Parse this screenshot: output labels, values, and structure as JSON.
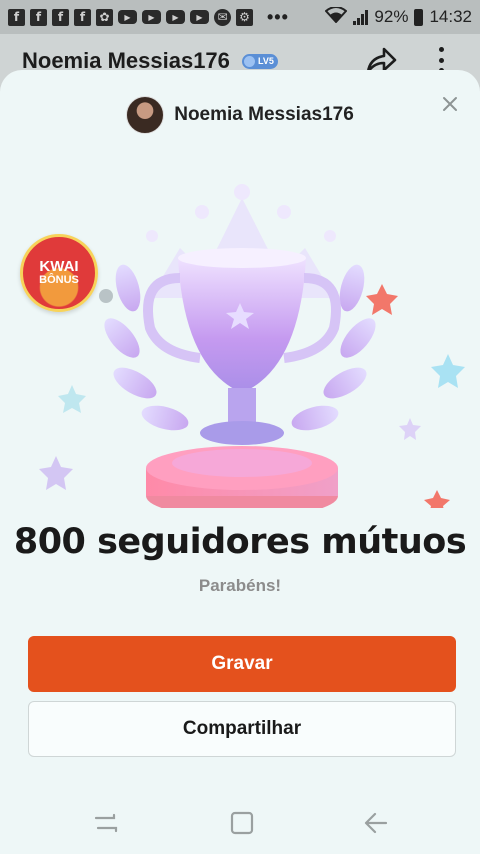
{
  "status_bar": {
    "notification_icons": [
      {
        "icon": "facebook-icon",
        "glyph": "f"
      },
      {
        "icon": "facebook-icon",
        "glyph": "f"
      },
      {
        "icon": "facebook-icon",
        "glyph": "f"
      },
      {
        "icon": "facebook-icon",
        "glyph": "f"
      },
      {
        "icon": "app-icon",
        "glyph": "✿"
      },
      {
        "icon": "youtube-icon",
        "glyph": "▶"
      },
      {
        "icon": "youtube-icon",
        "glyph": "▶"
      },
      {
        "icon": "youtube-icon",
        "glyph": "▶"
      },
      {
        "icon": "youtube-icon",
        "glyph": "▶"
      },
      {
        "icon": "messenger-icon",
        "glyph": "✉"
      },
      {
        "icon": "app-icon",
        "glyph": "⚙"
      }
    ],
    "more_notifications": "•••",
    "battery_percent": "92%",
    "time": "14:32"
  },
  "header": {
    "profile_name": "Noemia Messias176",
    "level_badge": "LV5"
  },
  "sheet": {
    "username": "Noemia Messias176",
    "kwai_bonus": {
      "line1": "KWAI",
      "line2": "BÔNUS"
    },
    "achievement_title": "800 seguidores mútuos",
    "subtitle": "Parabéns!",
    "primary_button": "Gravar",
    "secondary_button": "Compartilhar"
  },
  "colors": {
    "accent": "#e4511d",
    "sheet_bg": "#eef7f7",
    "trophy": "#c59af0"
  }
}
